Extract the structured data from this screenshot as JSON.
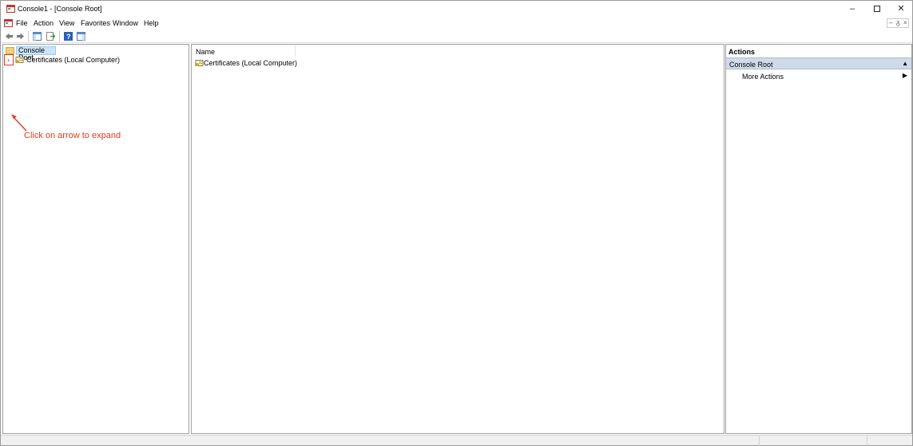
{
  "window": {
    "title": "Console1 - [Console Root]",
    "minimize_glyph": "–",
    "close_glyph": "✕"
  },
  "menu": {
    "items": [
      "File",
      "Action",
      "View",
      "Favorites",
      "Window",
      "Help"
    ],
    "mdi_min": "–",
    "mdi_restore": "ᵹ",
    "mdi_close": "×"
  },
  "toolbar": {
    "icons": [
      "back-arrow-icon",
      "forward-arrow-icon",
      "show-hide-tree-icon",
      "export-list-icon",
      "help-icon",
      "show-hide-action-pane-icon"
    ]
  },
  "tree": {
    "root_label": "Console Root",
    "child_label": "Certificates (Local Computer)",
    "expander_glyph": "›"
  },
  "annotation": {
    "text": "Click on arrow to expand",
    "color": "#e23a1e"
  },
  "list": {
    "column_header": "Name",
    "rows": [
      "Certificates (Local Computer)"
    ]
  },
  "actions": {
    "header": "Actions",
    "section_title": "Console Root",
    "collapse_glyph": "▲",
    "items": [
      "More Actions"
    ],
    "submenu_glyph": "▶"
  }
}
